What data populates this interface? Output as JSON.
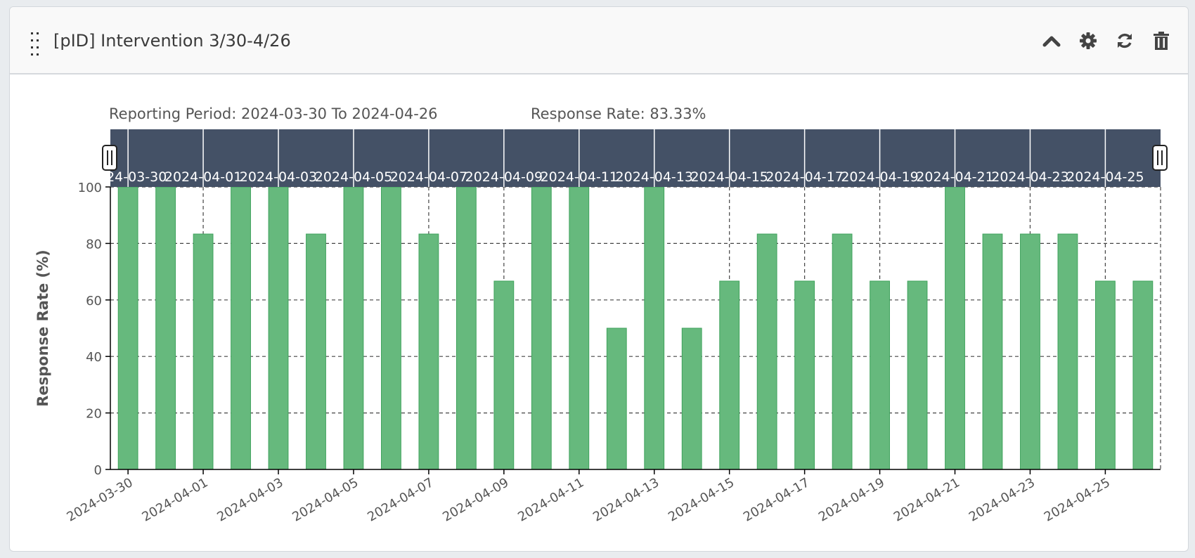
{
  "panel": {
    "title": "[pID] Intervention 3/30-4/26",
    "tools": [
      "chevron-up-icon",
      "gear-icon",
      "refresh-icon",
      "trash-icon"
    ]
  },
  "summary": {
    "period": "Reporting Period: 2024-03-30 To 2024-04-26",
    "rate": "Response Rate: 83.33%"
  },
  "chart_data": {
    "type": "bar",
    "title": "",
    "xlabel": "",
    "ylabel": "Response Rate (%)",
    "ylim": [
      0,
      100
    ],
    "yticks": [
      0,
      20,
      40,
      60,
      80,
      100
    ],
    "grid": true,
    "range_slider": true,
    "bar_color": "#66b97d",
    "bar_edge": "#3fa25c",
    "slider_color": "#445166",
    "categories": [
      "2024-03-30",
      "2024-03-31",
      "2024-04-01",
      "2024-04-02",
      "2024-04-03",
      "2024-04-04",
      "2024-04-05",
      "2024-04-06",
      "2024-04-07",
      "2024-04-08",
      "2024-04-09",
      "2024-04-10",
      "2024-04-11",
      "2024-04-12",
      "2024-04-13",
      "2024-04-14",
      "2024-04-15",
      "2024-04-16",
      "2024-04-17",
      "2024-04-18",
      "2024-04-19",
      "2024-04-20",
      "2024-04-21",
      "2024-04-22",
      "2024-04-23",
      "2024-04-24",
      "2024-04-25",
      "2024-04-26"
    ],
    "values": [
      100,
      100,
      83.33,
      100,
      100,
      83.33,
      100,
      100,
      83.33,
      100,
      66.67,
      100,
      100,
      50,
      100,
      50,
      66.67,
      83.33,
      66.67,
      83.33,
      66.67,
      66.67,
      100,
      83.33,
      83.33,
      83.33,
      66.67,
      66.67
    ],
    "xticks": [
      "2024-03-30",
      "2024-04-01",
      "2024-04-03",
      "2024-04-05",
      "2024-04-07",
      "2024-04-09",
      "2024-04-11",
      "2024-04-13",
      "2024-04-15",
      "2024-04-17",
      "2024-04-19",
      "2024-04-21",
      "2024-04-23",
      "2024-04-25"
    ]
  }
}
